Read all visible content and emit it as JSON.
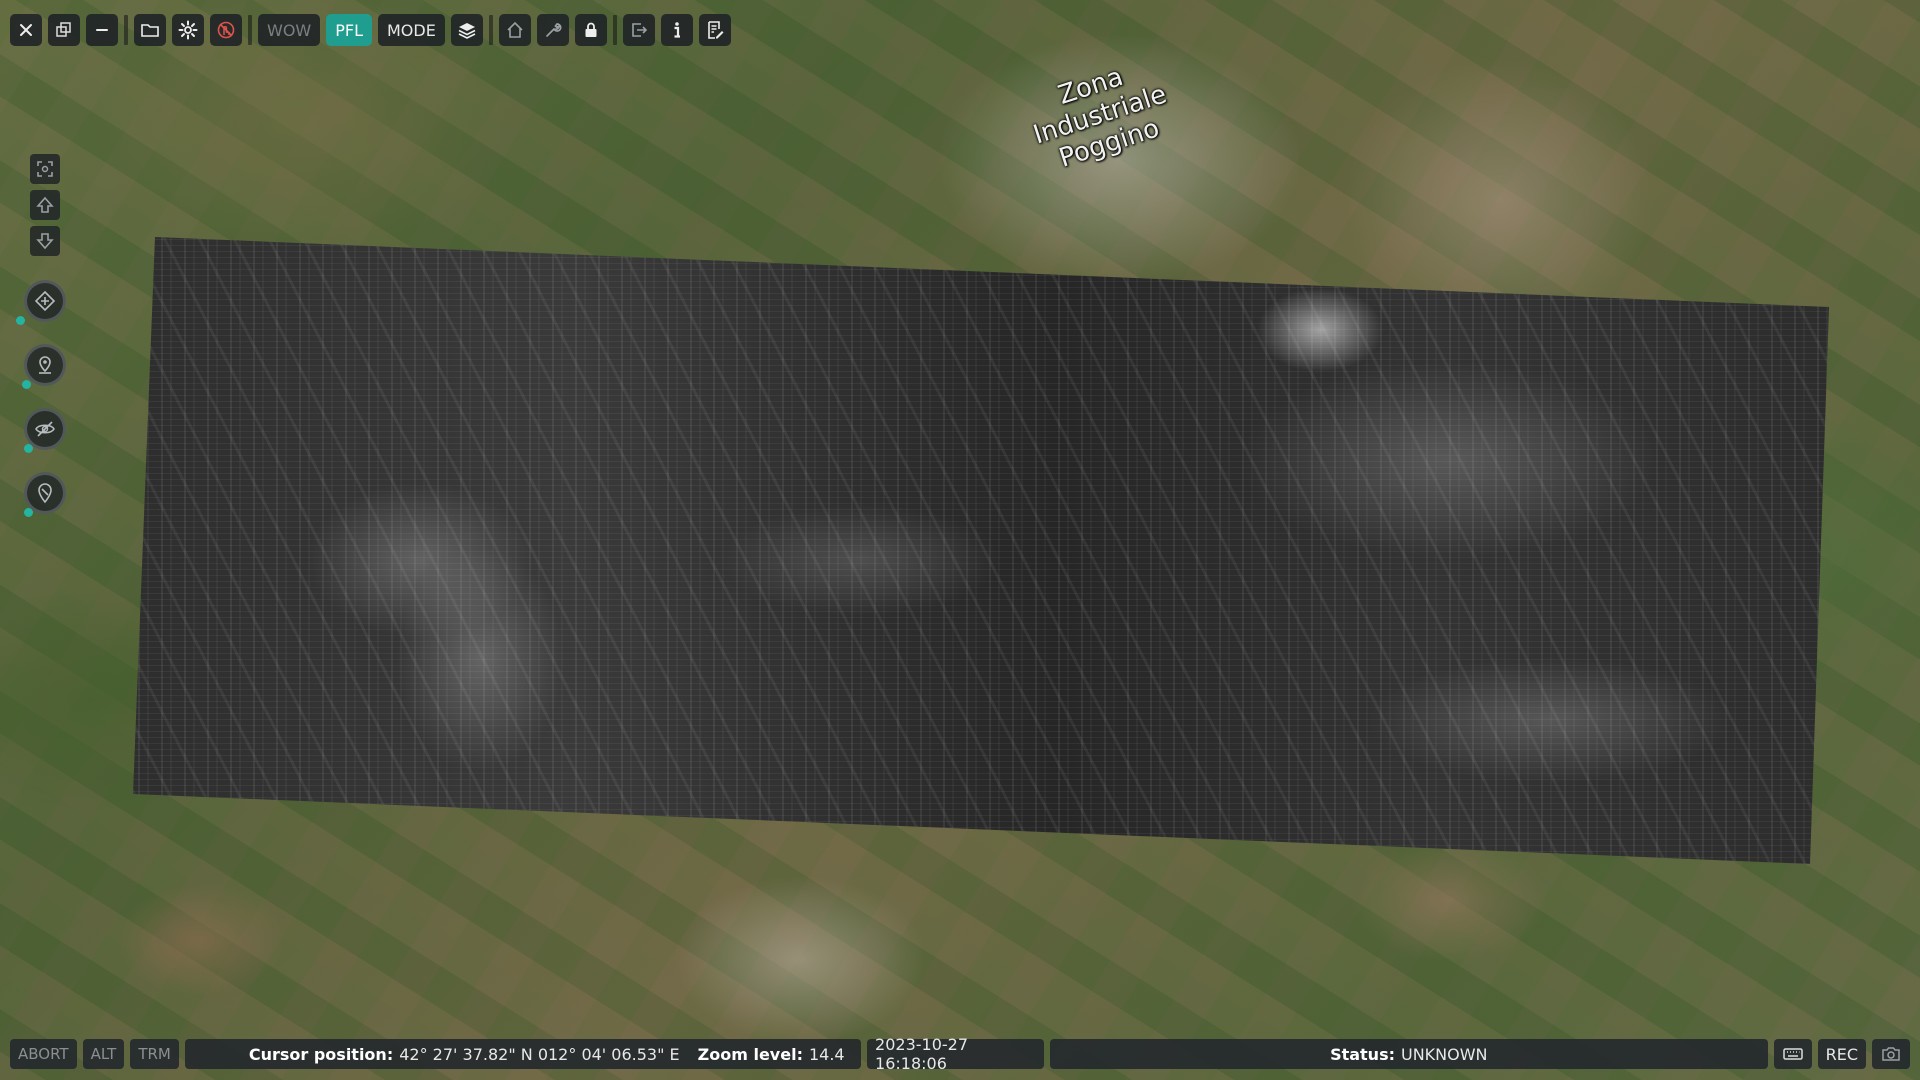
{
  "map": {
    "place_label_lines": [
      "Zona",
      "Industriale",
      "Poggino"
    ]
  },
  "toolbar": {
    "close_icon": "close-icon",
    "copy_icon": "copy-windows-icon",
    "minimize_icon": "minimize-icon",
    "folder_icon": "folder-icon",
    "gear_icon": "gear-icon",
    "alert_icon": "touch-alert-icon",
    "wow_label": "WOW",
    "pfl_label": "PFL",
    "mode_label": "MODE",
    "layers_icon": "layers-icon",
    "home_icon": "home-icon",
    "wrench_icon": "wrench-icon",
    "lock_icon": "lock-icon",
    "export_icon": "export-icon",
    "info_icon": "info-icon",
    "list_icon": "list-edit-icon"
  },
  "colors": {
    "accent": "#1f9e8f",
    "alert": "#e0524c",
    "toolbar_bg": "#1e2226",
    "status_dot": "#25b3a2"
  },
  "lefttools": {
    "items": [
      "fit-view-icon",
      "arrow-up-icon",
      "arrow-down-icon",
      "waypoint-nav-icon",
      "drone-target-icon",
      "hidden-eye-icon",
      "pin-marker-icon"
    ]
  },
  "status": {
    "abort_label": "ABORT",
    "alt_label": "ALT",
    "trm_label": "TRM",
    "cursor_label": "Cursor position:",
    "cursor_value": "42° 27' 37.82\" N 012° 04' 06.53\" E",
    "zoom_label": "Zoom level:",
    "zoom_value": "14.4",
    "datetime": "2023-10-27 16:18:06",
    "status_label": "Status:",
    "status_value": "UNKNOWN",
    "rec_label": "REC",
    "keyboard_icon": "keyboard-icon",
    "camera_icon": "camera-icon"
  }
}
